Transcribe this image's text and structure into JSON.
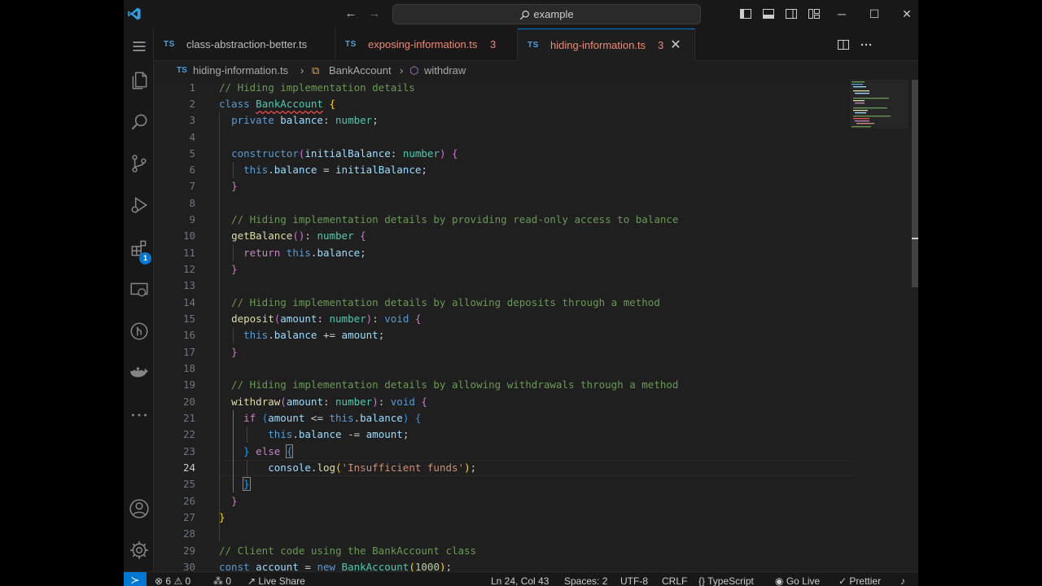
{
  "titlebar": {
    "search_text": "example",
    "back_icon": "arrow-left",
    "forward_icon": "arrow-right",
    "minimize": "─",
    "maximize": "☐",
    "close": "✕"
  },
  "activity": {
    "extensions_badge": "1"
  },
  "tabs": [
    {
      "icon": "TS",
      "label": "class-abstraction-better.ts",
      "problems": "",
      "color": "#cccccc"
    },
    {
      "icon": "TS",
      "label": "exposing-information.ts",
      "problems": "3",
      "color": "#f48771"
    },
    {
      "icon": "TS",
      "label": "hiding-information.ts",
      "problems": "3",
      "color": "#f48771"
    }
  ],
  "breadcrumb": {
    "file_icon": "TS",
    "file": "hiding-information.ts",
    "class_name": "BankAccount",
    "method": "withdraw"
  },
  "editor": {
    "line_numbers": [
      "1",
      "2",
      "3",
      "4",
      "5",
      "6",
      "7",
      "8",
      "9",
      "10",
      "11",
      "12",
      "13",
      "14",
      "15",
      "16",
      "17",
      "18",
      "19",
      "20",
      "21",
      "22",
      "23",
      "24",
      "25",
      "26",
      "27",
      "28",
      "29",
      "30"
    ],
    "current_line": "24",
    "lines": [
      "// Hiding implementation details",
      "class BankAccount {",
      "  private balance: number;",
      "",
      "  constructor(initialBalance: number) {",
      "    this.balance = initialBalance;",
      "  }",
      "",
      "  // Hiding implementation details by providing read-only access to balance",
      "  getBalance(): number {",
      "    return this.balance;",
      "  }",
      "",
      "  // Hiding implementation details by allowing deposits through a method",
      "  deposit(amount: number): void {",
      "    this.balance += amount;",
      "  }",
      "",
      "  // Hiding implementation details by allowing withdrawals through a method",
      "  withdraw(amount: number): void {",
      "    if (amount <= this.balance) {",
      "      this.balance -= amount;",
      "    } else {",
      "      console.log('Insufficient funds');",
      "    }",
      "  }",
      "}",
      "",
      "// Client code using the BankAccount class",
      "const account = new BankAccount(1000);"
    ]
  },
  "statusbar": {
    "errors": "6",
    "warnings": "0",
    "ports": "0",
    "live_share": "Live Share",
    "position": "Ln 24, Col 43",
    "spaces": "Spaces: 2",
    "encoding": "UTF-8",
    "eol": "CRLF",
    "language": "TypeScript",
    "go_live": "Go Live",
    "prettier": "Prettier"
  }
}
